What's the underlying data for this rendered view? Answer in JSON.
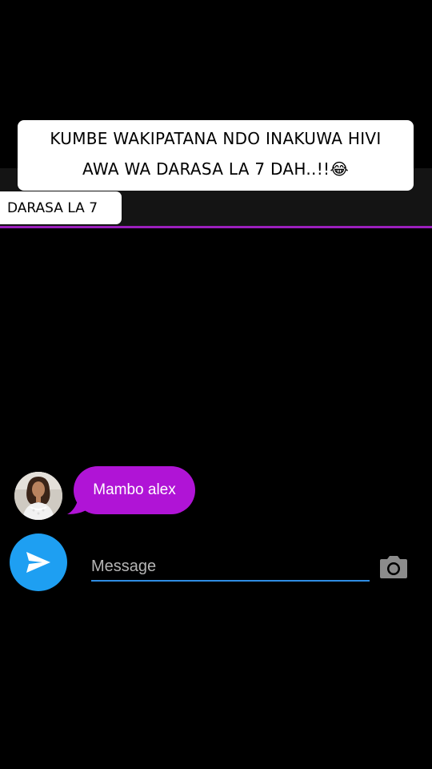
{
  "caption": {
    "line1": "KUMBE WAKIPATANA NDO INAKUWA HIVI",
    "line2": "AWA WA DARASA LA 7 DAH..!!😂"
  },
  "chat": {
    "title": "DARASA LA 7",
    "accent_color": "#9b1fbd"
  },
  "messages": [
    {
      "text": "Mambo alex",
      "bubble_color": "#b014d6"
    }
  ],
  "composer": {
    "placeholder": "Message",
    "send_icon": "send-icon",
    "camera_icon": "camera-icon",
    "send_color": "#1e9ff2"
  }
}
